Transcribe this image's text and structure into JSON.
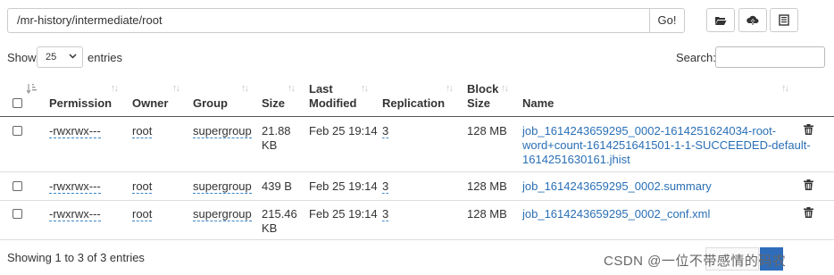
{
  "toolbar": {
    "path_value": "/mr-history/intermediate/root",
    "go_label": "Go!",
    "buttons": [
      {
        "icon": "folder-open-icon"
      },
      {
        "icon": "upload-cloud-icon"
      },
      {
        "icon": "clipboard-icon"
      }
    ]
  },
  "length": {
    "show_label": "Show",
    "selected": "25",
    "entries_label": "entries"
  },
  "search": {
    "label": "Search:",
    "value": ""
  },
  "table": {
    "headers": {
      "permission": "Permission",
      "owner": "Owner",
      "group": "Group",
      "size": "Size",
      "last_modified": "Last Modified",
      "last_modified_l1": "Last",
      "last_modified_l2": "Modified",
      "replication": "Replication",
      "block_size_l1": "Block",
      "block_size_l2": "Size",
      "name": "Name"
    },
    "rows": [
      {
        "permission": "-rwxrwx---",
        "owner": "root",
        "group": "supergroup",
        "size_l1": "21.88",
        "size_l2": "KB",
        "last_modified": "Feb 25 19:14",
        "replication": "3",
        "block_size": "128 MB",
        "name_l1": "job_1614243659295_0002-1614251624034-root-",
        "name_l2": "word+count-1614251641501-1-1-SUCCEEDED-default-",
        "name_l3": "1614251630161.jhist"
      },
      {
        "permission": "-rwxrwx---",
        "owner": "root",
        "group": "supergroup",
        "size_l1": "439 B",
        "last_modified": "Feb 25 19:14",
        "replication": "3",
        "block_size": "128 MB",
        "name_l1": "job_1614243659295_0002.summary"
      },
      {
        "permission": "-rwxrwx---",
        "owner": "root",
        "group": "supergroup",
        "size_l1": "215.46",
        "size_l2": "KB",
        "last_modified": "Feb 25 19:14",
        "replication": "3",
        "block_size": "128 MB",
        "name_l1": "job_1614243659295_0002_conf.xml"
      }
    ]
  },
  "footer": {
    "info": "Showing 1 to 3 of 3 entries",
    "watermark": "CSDN @一位不带感情的码农"
  },
  "colors": {
    "link": "#2a6fb5",
    "page_active": "#2f6dba"
  }
}
